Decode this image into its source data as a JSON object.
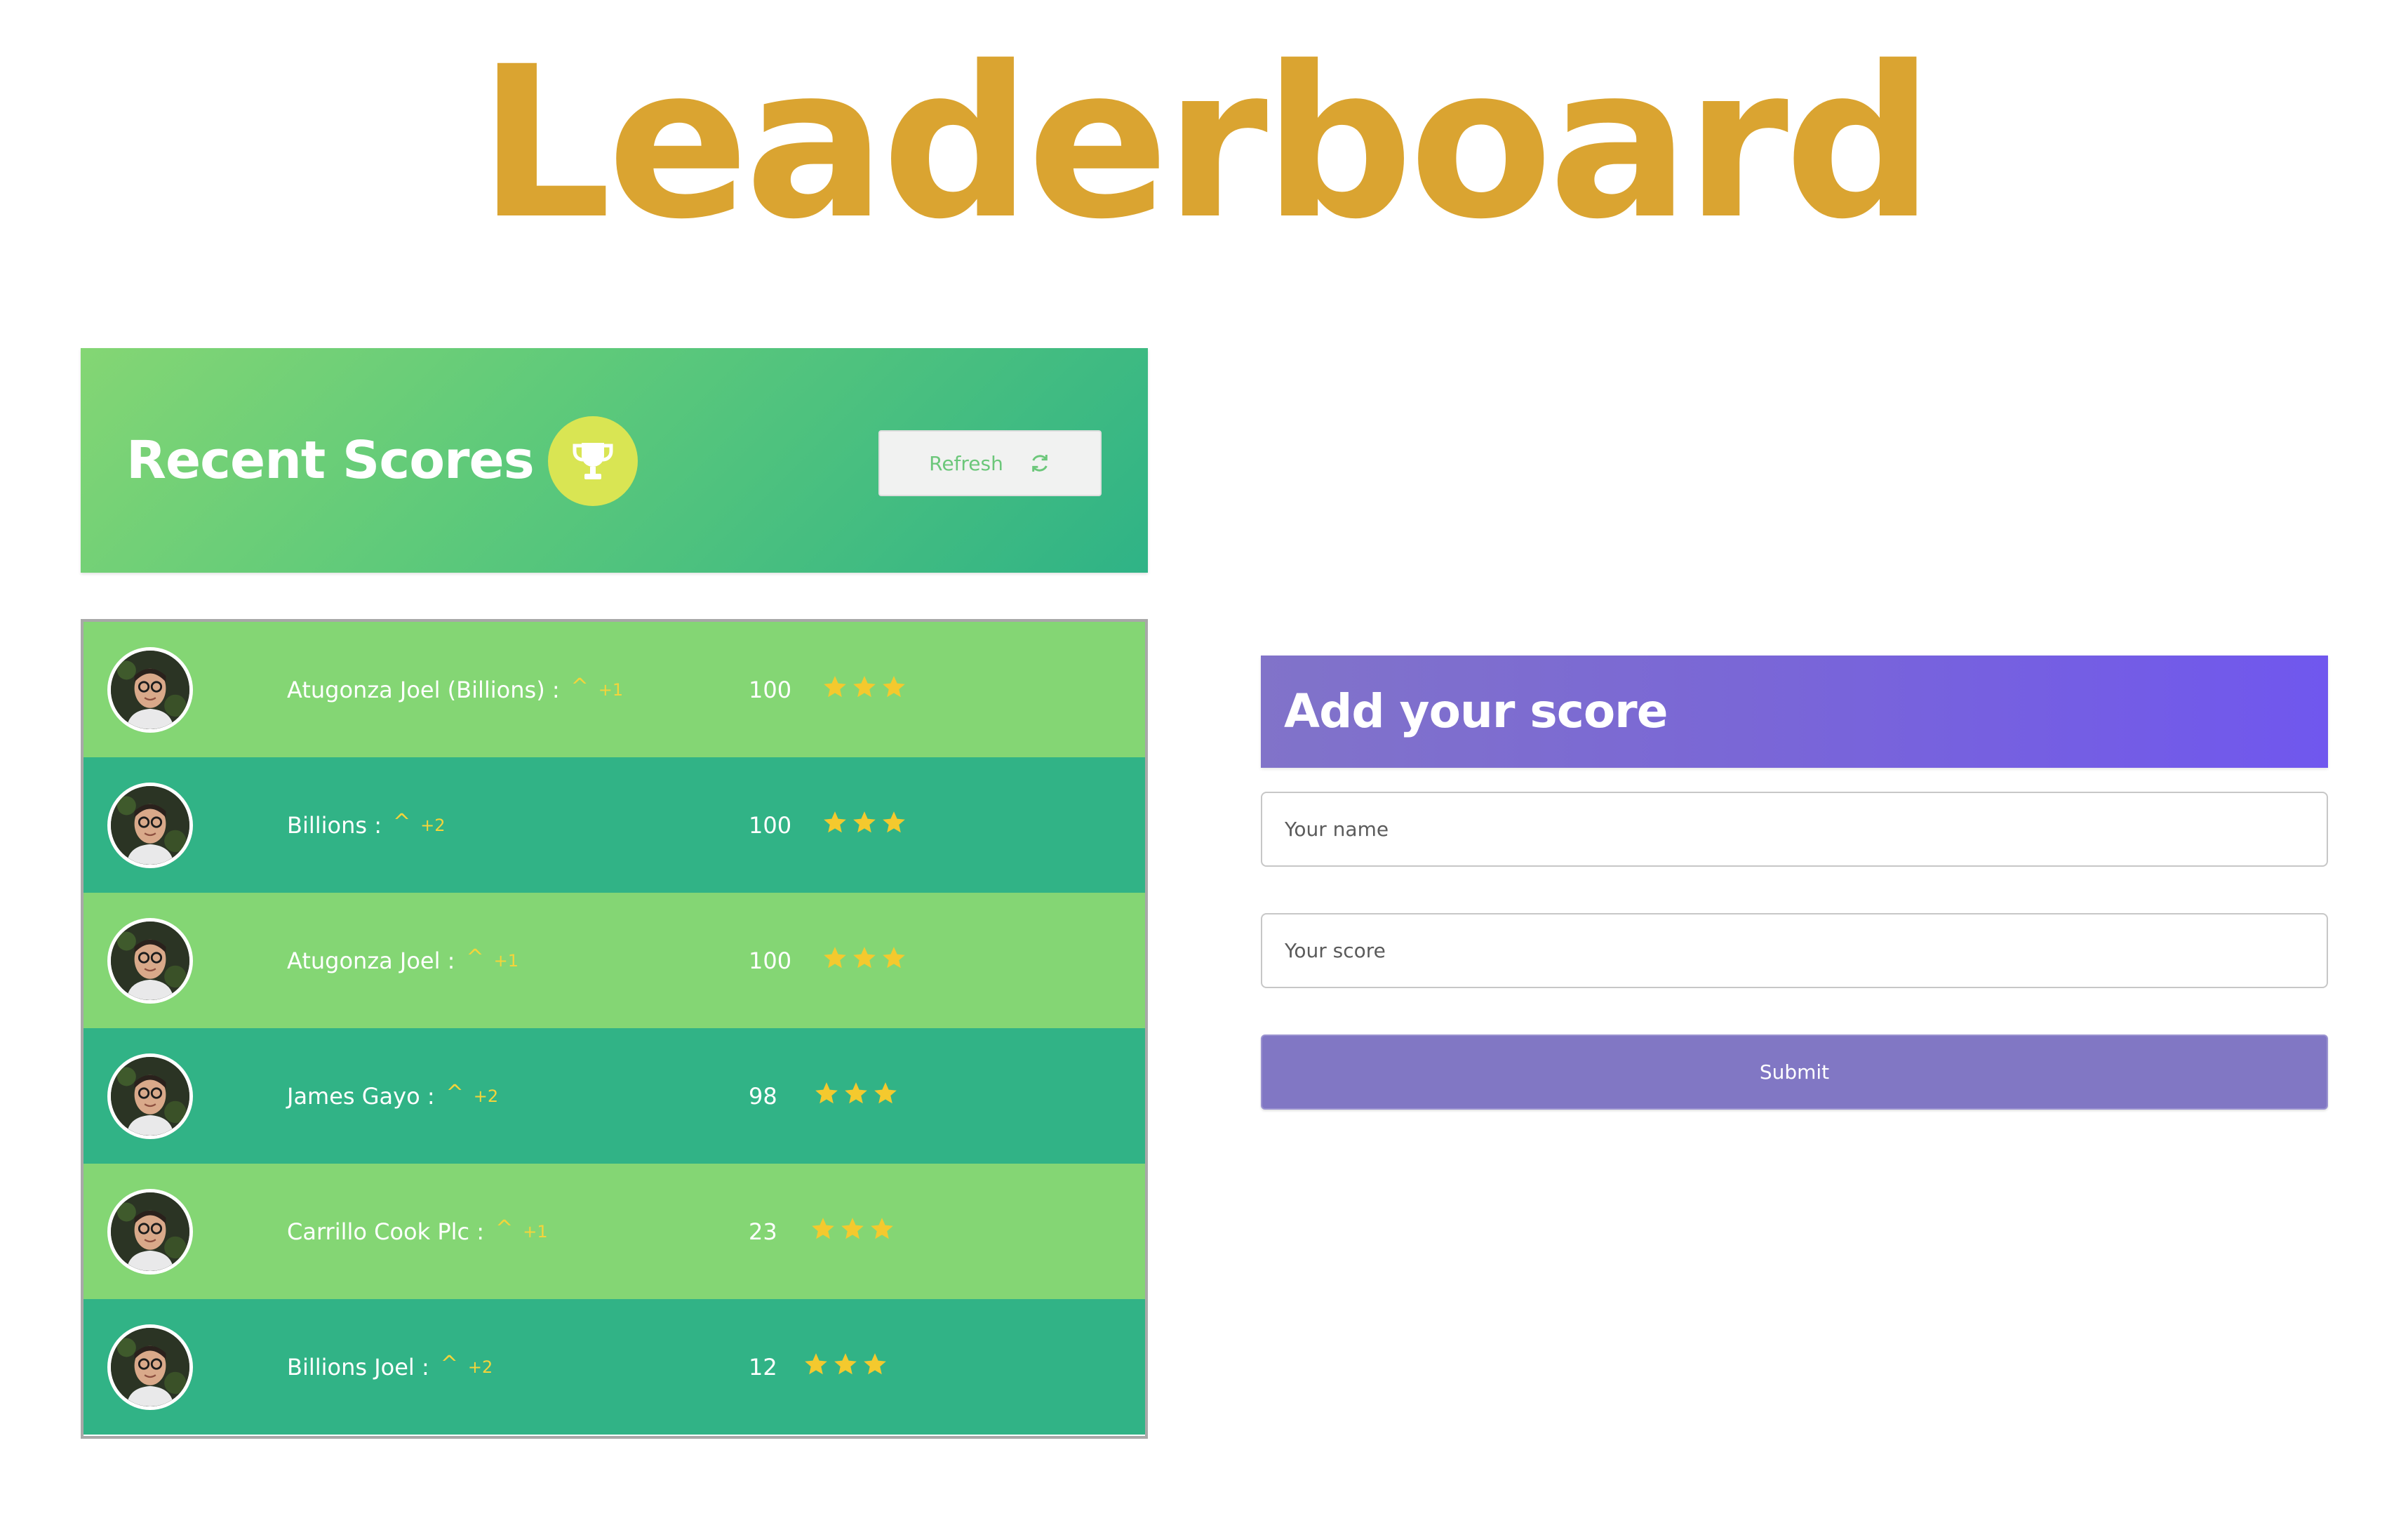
{
  "page": {
    "title": "Leaderboard"
  },
  "recent_scores": {
    "title": "Recent Scores",
    "trophy_icon": "trophy-icon",
    "refresh_label": "Refresh",
    "refresh_icon": "refresh-icon",
    "rows": [
      {
        "name": "Atugonza Joel (Billions) :",
        "chevron": "^",
        "delta": "+1",
        "score": "100",
        "stars": 3
      },
      {
        "name": "Billions :",
        "chevron": "^",
        "delta": "+2",
        "score": "100",
        "stars": 3
      },
      {
        "name": "Atugonza Joel :",
        "chevron": "^",
        "delta": "+1",
        "score": "100",
        "stars": 3
      },
      {
        "name": "James Gayo :",
        "chevron": "^",
        "delta": "+2",
        "score": "98",
        "stars": 3
      },
      {
        "name": "Carrillo Cook Plc :",
        "chevron": "^",
        "delta": "+1",
        "score": "23",
        "stars": 3
      },
      {
        "name": "Billions Joel :",
        "chevron": "^",
        "delta": "+2",
        "score": "12",
        "stars": 3
      }
    ]
  },
  "add_score": {
    "title": "Add your score",
    "name_placeholder": "Your name",
    "score_placeholder": "Your score",
    "submit_label": "Submit"
  },
  "colors": {
    "title": "#daa431",
    "row_light": "#84d674",
    "row_dark": "#31b386",
    "accent_purple": "#7057ee",
    "submit": "#8177c4",
    "star": "#f4c92e"
  }
}
